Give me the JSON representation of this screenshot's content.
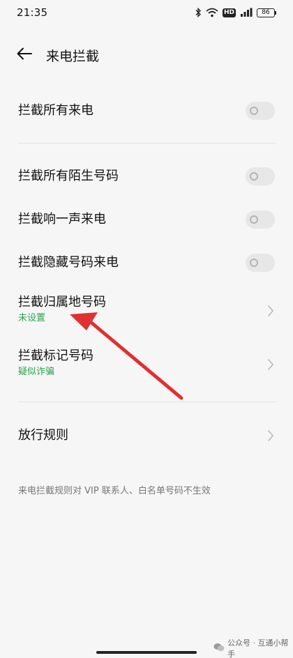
{
  "status_bar": {
    "time": "21:35",
    "hd_label": "HD",
    "battery_level": "86"
  },
  "header": {
    "back_icon": "arrow-left-icon",
    "title": "来电拦截"
  },
  "settings": {
    "block_all": {
      "label": "拦截所有来电",
      "enabled": false
    },
    "block_unknown": {
      "label": "拦截所有陌生号码",
      "enabled": false
    },
    "block_ring_once": {
      "label": "拦截响一声来电",
      "enabled": false
    },
    "block_hidden": {
      "label": "拦截隐藏号码来电",
      "enabled": false
    },
    "block_region": {
      "label": "拦截归属地号码",
      "sub": "未设置"
    },
    "block_marked": {
      "label": "拦截标记号码",
      "sub": "疑似诈骗"
    },
    "allow_rules": {
      "label": "放行规则"
    }
  },
  "footnote": "来电拦截规则对 VIP 联系人、白名单号码不生效",
  "watermark": "公众号 · 互通小帮手",
  "colors": {
    "background": "#f6f6f6",
    "sub_text_green": "#2aa44a",
    "annotation_arrow": "#e03030"
  }
}
